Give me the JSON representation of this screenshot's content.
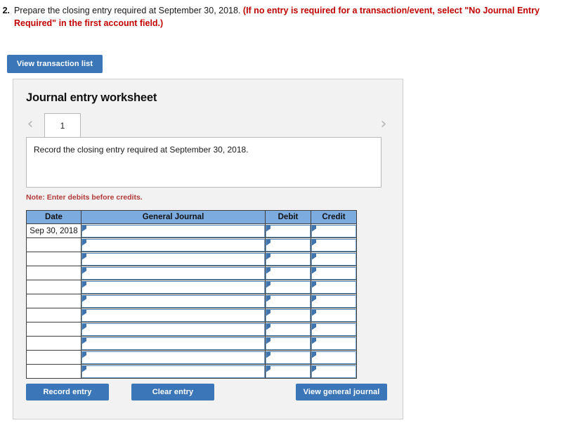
{
  "question": {
    "number": "2.",
    "text": "Prepare the closing entry required at September 30, 2018. ",
    "instruction_bold_red": "(If no entry is required for a transaction/event, select \"No Journal Entry Required\" in the first account field.)"
  },
  "toolbar": {
    "view_transaction_list_label": "View transaction list"
  },
  "panel": {
    "title": "Journal entry worksheet",
    "tabs": [
      {
        "label": "1",
        "active": true
      }
    ],
    "nav": {
      "prev_icon": "‹",
      "next_icon": "›"
    },
    "instruction": "Record the closing entry required at September 30, 2018.",
    "note": "Note: Enter debits before credits."
  },
  "table": {
    "columns": [
      "Date",
      "General Journal",
      "Debit",
      "Credit"
    ],
    "rows": [
      {
        "date": "Sep 30, 2018",
        "general_journal": "",
        "debit": "",
        "credit": ""
      },
      {
        "date": "",
        "general_journal": "",
        "debit": "",
        "credit": ""
      },
      {
        "date": "",
        "general_journal": "",
        "debit": "",
        "credit": ""
      },
      {
        "date": "",
        "general_journal": "",
        "debit": "",
        "credit": ""
      },
      {
        "date": "",
        "general_journal": "",
        "debit": "",
        "credit": ""
      },
      {
        "date": "",
        "general_journal": "",
        "debit": "",
        "credit": ""
      },
      {
        "date": "",
        "general_journal": "",
        "debit": "",
        "credit": ""
      },
      {
        "date": "",
        "general_journal": "",
        "debit": "",
        "credit": ""
      },
      {
        "date": "",
        "general_journal": "",
        "debit": "",
        "credit": ""
      },
      {
        "date": "",
        "general_journal": "",
        "debit": "",
        "credit": ""
      },
      {
        "date": "",
        "general_journal": "",
        "debit": "",
        "credit": ""
      }
    ]
  },
  "actions": {
    "record_entry_label": "Record entry",
    "clear_entry_label": "Clear entry",
    "view_general_journal_label": "View general journal"
  },
  "colors": {
    "button_blue": "#3a76b8",
    "table_header_blue": "#7cabe0",
    "panel_gray": "#f2f2f2",
    "note_red": "#b33a3a",
    "instruction_red": "#c00000",
    "input_marker_blue": "#3f74ae"
  }
}
